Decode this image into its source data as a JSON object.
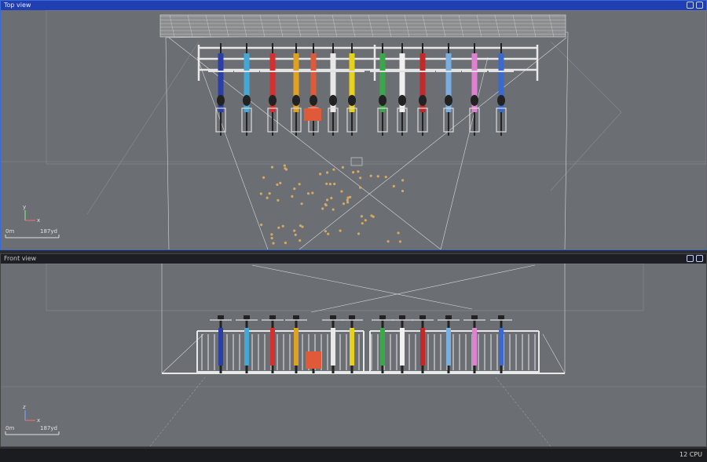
{
  "viewports": {
    "top": {
      "title": "Top view",
      "axis_y": "y",
      "axis_x": "x",
      "scale_left": "0m",
      "scale_right": "187yd"
    },
    "front": {
      "title": "Front view",
      "axis_y": "z",
      "axis_x": "x",
      "scale_left": "0m",
      "scale_right": "187yd"
    }
  },
  "status_bar": {
    "cpu": "12 CPU"
  },
  "colors": {
    "selection_border": "#3a6ad8",
    "viewport_bg": "#6b6e73",
    "bikes": [
      "#2b3fa8",
      "#43a8d8",
      "#d62f2f",
      "#e0a020",
      "#e05a3a",
      "#e8e8e8",
      "#e6d21a",
      "#3aa84a",
      "#f0f0f0",
      "#c42828",
      "#78aee0",
      "#e080d0",
      "#3a6ad0"
    ]
  }
}
